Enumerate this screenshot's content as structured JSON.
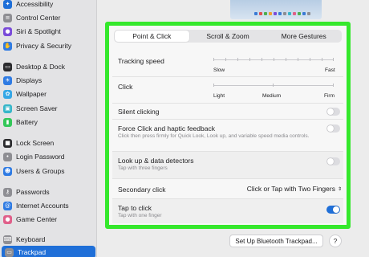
{
  "sidebar": {
    "items": [
      {
        "label": "Accessibility",
        "icon": "accessibility-icon",
        "color": "#1f6fd8",
        "glyph": "✦"
      },
      {
        "label": "Control Center",
        "icon": "control-center-icon",
        "color": "#8e8e93",
        "glyph": "≡"
      },
      {
        "label": "Siri & Spotlight",
        "icon": "siri-icon",
        "color": "#7a4bd9",
        "glyph": "●"
      },
      {
        "label": "Privacy & Security",
        "icon": "hand-icon",
        "color": "#2f7be3",
        "glyph": "✋"
      },
      {
        "label": "Desktop & Dock",
        "icon": "dock-icon",
        "color": "#2b2b2e",
        "glyph": "▭"
      },
      {
        "label": "Displays",
        "icon": "display-icon",
        "color": "#2f7be3",
        "glyph": "☀"
      },
      {
        "label": "Wallpaper",
        "icon": "wallpaper-icon",
        "color": "#35a7e6",
        "glyph": "✿"
      },
      {
        "label": "Screen Saver",
        "icon": "screen-saver-icon",
        "color": "#36b6c9",
        "glyph": "▣"
      },
      {
        "label": "Battery",
        "icon": "battery-icon",
        "color": "#34c759",
        "glyph": "▮"
      },
      {
        "label": "Lock Screen",
        "icon": "lock-icon",
        "color": "#2b2b2e",
        "glyph": "■"
      },
      {
        "label": "Login Password",
        "icon": "password-icon",
        "color": "#8e8e93",
        "glyph": "•"
      },
      {
        "label": "Users & Groups",
        "icon": "users-icon",
        "color": "#2f7be3",
        "glyph": "☻"
      },
      {
        "label": "Passwords",
        "icon": "key-icon",
        "color": "#8e8e93",
        "glyph": "⚷"
      },
      {
        "label": "Internet Accounts",
        "icon": "at-icon",
        "color": "#2f7be3",
        "glyph": "@"
      },
      {
        "label": "Game Center",
        "icon": "game-center-icon",
        "color": "#e0608a",
        "glyph": "●"
      },
      {
        "label": "Keyboard",
        "icon": "keyboard-icon",
        "color": "#8e8e93",
        "glyph": "⌨"
      },
      {
        "label": "Trackpad",
        "icon": "trackpad-icon",
        "color": "#8e8e93",
        "glyph": "▭",
        "selected": true
      }
    ]
  },
  "tabs": [
    "Point & Click",
    "Scroll & Zoom",
    "More Gestures"
  ],
  "active_tab": "Point & Click",
  "settings": {
    "tracking_speed": {
      "label": "Tracking speed",
      "min_label": "Slow",
      "max_label": "Fast"
    },
    "click": {
      "label": "Click",
      "options": [
        "Light",
        "Medium",
        "Firm"
      ],
      "value": "Medium"
    },
    "silent_clicking": {
      "label": "Silent clicking",
      "enabled": false
    },
    "force_click": {
      "label": "Force Click and haptic feedback",
      "description": "Click then press firmly for Quick Look, Look up, and variable speed media controls.",
      "enabled": false
    },
    "look_up": {
      "label": "Look up & data detectors",
      "description": "Tap with three fingers",
      "enabled": false
    },
    "secondary_click": {
      "label": "Secondary click",
      "value": "Click or Tap with Two Fingers"
    },
    "tap_to_click": {
      "label": "Tap to click",
      "description": "Tap with one finger",
      "enabled": true
    }
  },
  "footer": {
    "bluetooth_button": "Set Up Bluetooth Trackpad...",
    "help_button": "?"
  },
  "colors": {
    "accent": "#1f6fd8",
    "highlight_border": "#35e82c"
  }
}
